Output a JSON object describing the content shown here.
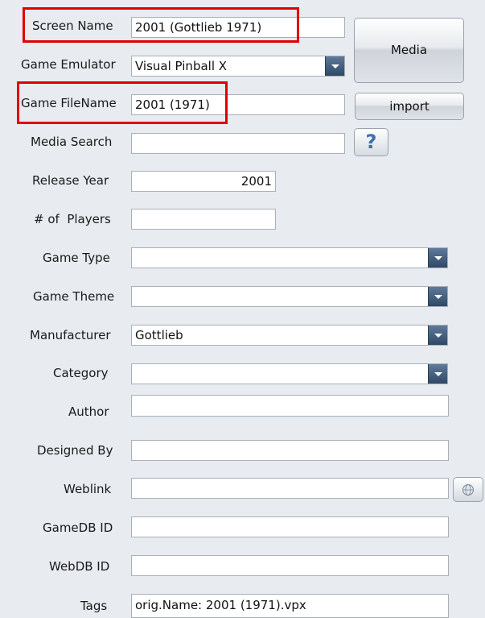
{
  "form": {
    "screen_name": {
      "label": "Screen Name",
      "value": "2001 (Gottlieb 1971)"
    },
    "game_emulator": {
      "label": "Game Emulator",
      "value": "Visual Pinball X"
    },
    "game_filename": {
      "label": "Game FileName",
      "value": "2001 (1971)"
    },
    "media_search": {
      "label": "Media Search",
      "value": ""
    },
    "release_year": {
      "label": "Release Year",
      "value": "2001"
    },
    "num_players": {
      "label": "# of  Players",
      "value": ""
    },
    "game_type": {
      "label": "Game Type",
      "value": ""
    },
    "game_theme": {
      "label": "Game Theme",
      "value": ""
    },
    "manufacturer": {
      "label": "Manufacturer",
      "value": "Gottlieb"
    },
    "category": {
      "label": "Category",
      "value": ""
    },
    "author": {
      "label": "Author",
      "value": ""
    },
    "designed_by": {
      "label": "Designed By",
      "value": ""
    },
    "weblink": {
      "label": "Weblink",
      "value": ""
    },
    "gamedb_id": {
      "label": "GameDB ID",
      "value": ""
    },
    "webdb_id": {
      "label": "WebDB ID",
      "value": ""
    },
    "tags": {
      "label": "Tags",
      "value": "orig.Name: 2001 (1971).vpx"
    }
  },
  "buttons": {
    "media": "Media",
    "import": "import",
    "help_glyph": "?"
  },
  "icons": {
    "help": "question-mark-icon",
    "weblink": "globe-icon"
  },
  "colors": {
    "highlight": "#e00000",
    "dropdown": "#34506f",
    "help_button": "#3f6fb0"
  }
}
